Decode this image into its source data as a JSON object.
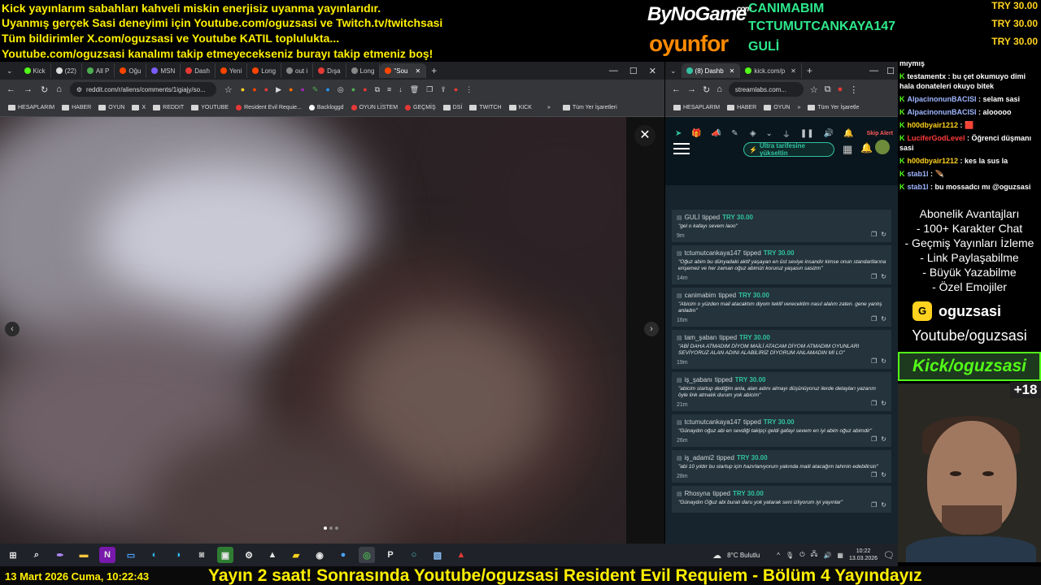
{
  "overlay": {
    "ticker_lines": [
      "Kick yayınlarım sabahları kahveli miskin enerjisiz uyanma yayınlarıdır.",
      "Uyanmış gerçek Sasi deneyimi için Youtube.com/oguzsasi ve Twitch.tv/twitchsasi",
      "Tüm bildirimler X.com/oguzsasi ve Youtube KATIL toplulukta...",
      "Youtube.com/oguzsasi kanalımı takip etmeyecekseniz burayı takip etmeniz boş!"
    ],
    "logos": {
      "bynogame": "ByNoGame",
      "bynogame_com": ".com",
      "oyunfor": "oyunfor"
    },
    "top_donors": [
      {
        "name": "CANIMABIM",
        "amount": "TRY 30.00"
      },
      {
        "name": "TCTUMUTCANKAYA147",
        "amount": "TRY 30.00"
      },
      {
        "name": "GULİ",
        "amount": "TRY 30.00"
      }
    ]
  },
  "main_browser": {
    "tabs": [
      "Kick",
      "(22)",
      "All P",
      "Oğu",
      "MSN",
      "Dash",
      "Yeni",
      "Long",
      "out i",
      "Dışa",
      "Long",
      "\"Sou"
    ],
    "url": "reddit.com/r/aliens/comments/1igiajy/so...",
    "bookmarks": [
      "HESAPLARIM",
      "HABER",
      "OYUN",
      "X",
      "REDDIT",
      "YOUTUBE",
      "Resident Evil Requie...",
      "Backloggd",
      "OYUN LİSTEM",
      "GEÇMİŞ",
      "DSİ",
      "TWITCH",
      "KICK"
    ],
    "bookmarks_other": "Tüm Yer İşaretleri",
    "close_glyph": "✕"
  },
  "side_browser": {
    "tabs": [
      "(8) Dashb",
      "kick.com/p"
    ],
    "url": "streamlabs.com...",
    "bookmarks": [
      "HESAPLARIM",
      "HABER",
      "OYUN"
    ],
    "bookmarks_other": "Tüm Yer İşaretle",
    "upgrade_label": "Ultra tarifesine yükseltin",
    "skip_alert": "Skip Alert",
    "events": [
      {
        "user": "GULİ",
        "verb": "tipped",
        "amount": "TRY 30.00",
        "message": "\"gel o kafayı sevem laoo\"",
        "time": "9m"
      },
      {
        "user": "tctumutcankaya147",
        "verb": "tipped",
        "amount": "TRY 30.00",
        "message": "\"Oğuz abim bu dünyadaki aktif yaşayan en üst seviye insandır kimse onun standartlarına erişemez ve her zaman oğuz abimizi koruruz yaşasın sasizm\"",
        "time": "14m"
      },
      {
        "user": "canimabim",
        "verb": "tipped",
        "amount": "TRY 30.00",
        "message": "\"Abicim o yüzden mail atacaktım diyom teklif verecektim nasıl alalım zaten. gene yanlış anladın\"",
        "time": "16m"
      },
      {
        "user": "tam_şaban",
        "verb": "tipped",
        "amount": "TRY 30.00",
        "message": "\"ABİ DAHA ATMADIM DİYOM MAİLİ ATACAM DİYOM ATMADIM OYUNLARI SEVİYORUZ ALAN ADINI ALABİLİRİZ DİYORUM ANLAMADIN Mİ LO\"",
        "time": "19m"
      },
      {
        "user": "iş_şabanı",
        "verb": "tipped",
        "amount": "TRY 30.00",
        "message": "\"abicim startup dediğim anla, alan adını almayı düşünüyoruz ilerde detayları yazarım öyle link atmalık durum yok abicim\"",
        "time": "21m"
      },
      {
        "user": "tctumutcankaya147",
        "verb": "tipped",
        "amount": "TRY 30.00",
        "message": "\"Günaydın oğuz abi en sevdiği takipçi geldi gafayi sevem en iyi abim oğuz abimdir\"",
        "time": "26m"
      },
      {
        "user": "iş_adami2",
        "verb": "tipped",
        "amount": "TRY 30.00",
        "message": "\"abi 10 yıldır bu startup için hazırlanıyorum yakında maili atacağım tahmin edebilirsin\"",
        "time": "28m"
      },
      {
        "user": "Rhosyna",
        "verb": "tipped",
        "amount": "TRY 30.00",
        "message": "\"Günaydın Oğuz abi buralı daru yok yatarak seni izliyorum iyi yayınlar\"",
        "time": ""
      }
    ]
  },
  "chat": {
    "lines": [
      {
        "user": "",
        "text": "mıymış",
        "color": "#ffffff"
      },
      {
        "user": "testamentx",
        "text": "bu çet okumuyo dimi hala donateleri okuyo bitek",
        "color": "#ffffff"
      },
      {
        "user": "AlpacinonunBACISI",
        "text": "selam sasi",
        "color": "#9fb6ff"
      },
      {
        "user": "AlpacinonunBACISI",
        "text": "alooooo",
        "color": "#9fb6ff"
      },
      {
        "user": "h00dbyair1212",
        "text": "🟥",
        "color": "#ffd21f"
      },
      {
        "user": "LuciferGodLevel",
        "text": "Öğrenci düşmanı sasi",
        "color": "#ff3b3b"
      },
      {
        "user": "h00dbyair1212",
        "text": "kes la sus la",
        "color": "#ffd21f"
      },
      {
        "user": "stab1l",
        "text": "🪶",
        "color": "#9fb6ff"
      },
      {
        "user": "stab1l",
        "text": "bu mossadcı mı @oguzsasi",
        "color": "#9fb6ff"
      }
    ]
  },
  "benefits": {
    "title": "Abonelik Avantajları",
    "items": [
      "- 100+ Karakter Chat",
      "- Geçmiş Yayınları İzleme",
      "- Link Paylaşabilme",
      "- Büyük Yazabilme",
      "- Özel Emojiler"
    ]
  },
  "kick_badge": {
    "name": "oguzsasi",
    "letter": "G"
  },
  "youtube_text": "Youtube/oguzsasi",
  "kick_text": "Kick/oguzsasi",
  "viewers": "+18",
  "taskbar": {
    "weather": "8°C  Bulutlu",
    "time": "10:22",
    "date": "13.03.2026"
  },
  "bottom": {
    "date": "13 Mart 2026 Cuma, 10:22:43",
    "marquee": "Yayın 2 saat! Sonrasında Youtube/oguzsasi Resident Evil Requiem - Bölüm 4 Yayındayız"
  },
  "colors": {
    "kick_green": "#53fc18",
    "ticker_yellow": "#ffef00",
    "streamlabs_teal": "#31c3a2"
  }
}
